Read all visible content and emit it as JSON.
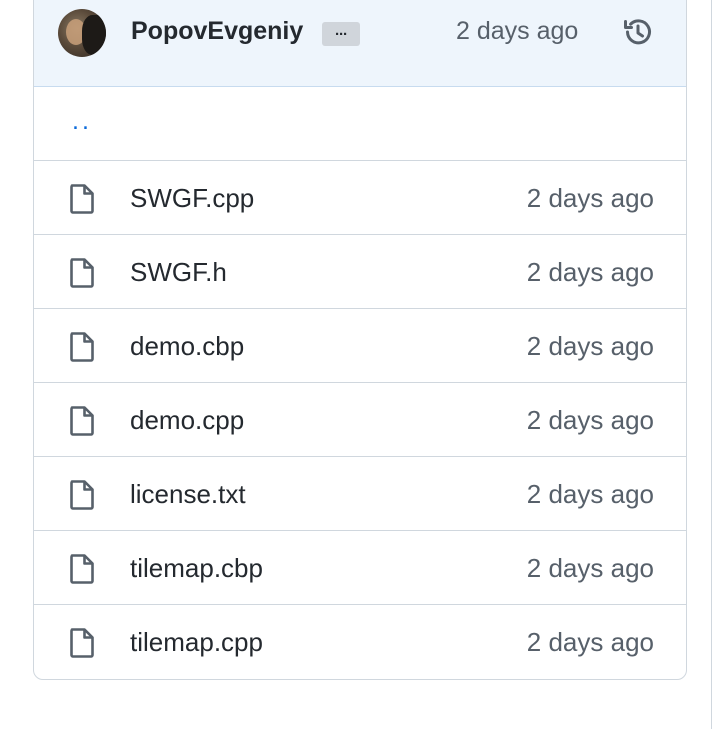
{
  "commit": {
    "author": "PopovEvgeniy",
    "more_label": "···",
    "time": "2 days ago",
    "history_icon": "history-icon"
  },
  "parent_dir": {
    "label": ".."
  },
  "files": [
    {
      "name": "SWGF.cpp",
      "time": "2 days ago",
      "icon": "file-icon"
    },
    {
      "name": "SWGF.h",
      "time": "2 days ago",
      "icon": "file-icon"
    },
    {
      "name": "demo.cbp",
      "time": "2 days ago",
      "icon": "file-icon"
    },
    {
      "name": "demo.cpp",
      "time": "2 days ago",
      "icon": "file-icon"
    },
    {
      "name": "license.txt",
      "time": "2 days ago",
      "icon": "file-icon"
    },
    {
      "name": "tilemap.cbp",
      "time": "2 days ago",
      "icon": "file-icon"
    },
    {
      "name": "tilemap.cpp",
      "time": "2 days ago",
      "icon": "file-icon"
    }
  ],
  "colors": {
    "link": "#0969da",
    "header_bg": "#eef5fc",
    "border": "#d0d7de",
    "muted_text": "#57606a"
  }
}
